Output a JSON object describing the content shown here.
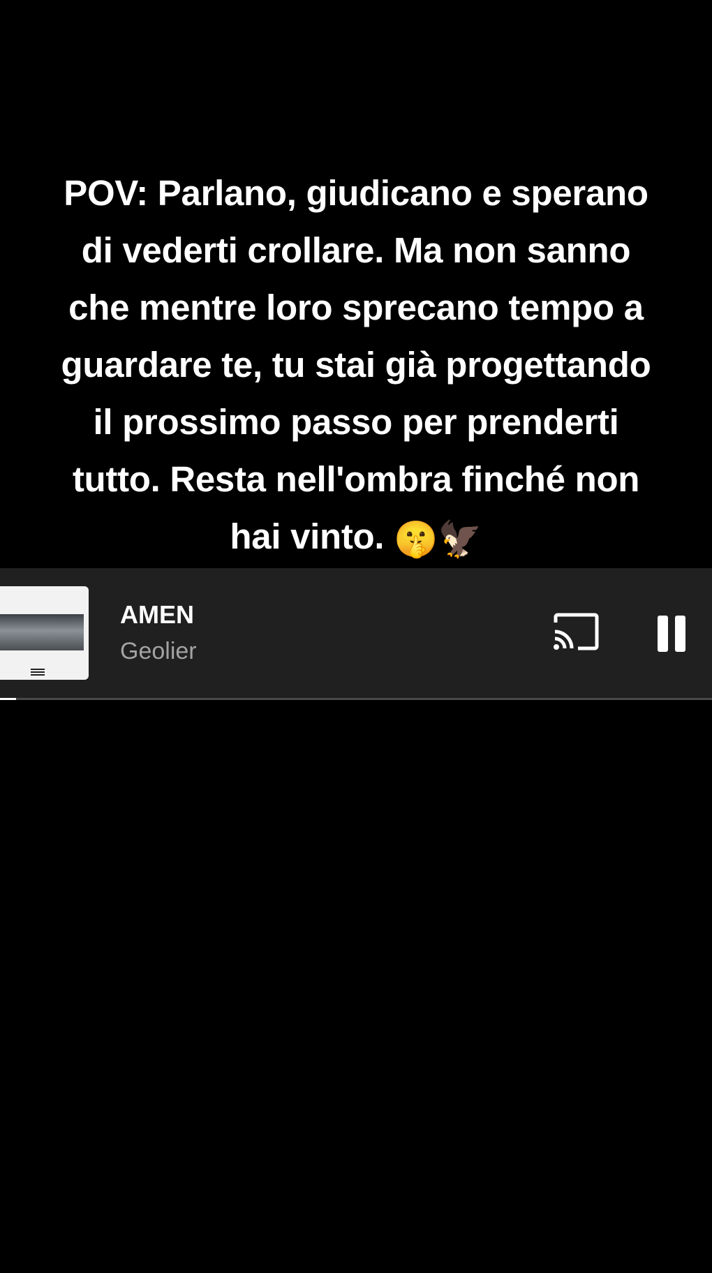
{
  "caption": {
    "lines": [
      "POV: Parlano, giudicano e sperano",
      "di vederti crollare. Ma non sanno",
      "che mentre loro sprecano tempo a",
      "guardare te, tu stai già progettando",
      "il prossimo passo per prenderti",
      "tutto. Resta nell'ombra finché non",
      "hai vinto."
    ],
    "emojis": "🤫🦅"
  },
  "player": {
    "title": "AMEN",
    "artist": "Geolier",
    "progress_percent": 2.3,
    "cast_icon": "cast-icon",
    "pause_icon": "pause-icon"
  },
  "colors": {
    "background": "#000000",
    "player_bg": "#202020",
    "title_text": "#ffffff",
    "artist_text": "#a3a3a3",
    "progress_track": "#4a4a4a",
    "progress_fill": "#ffffff"
  }
}
